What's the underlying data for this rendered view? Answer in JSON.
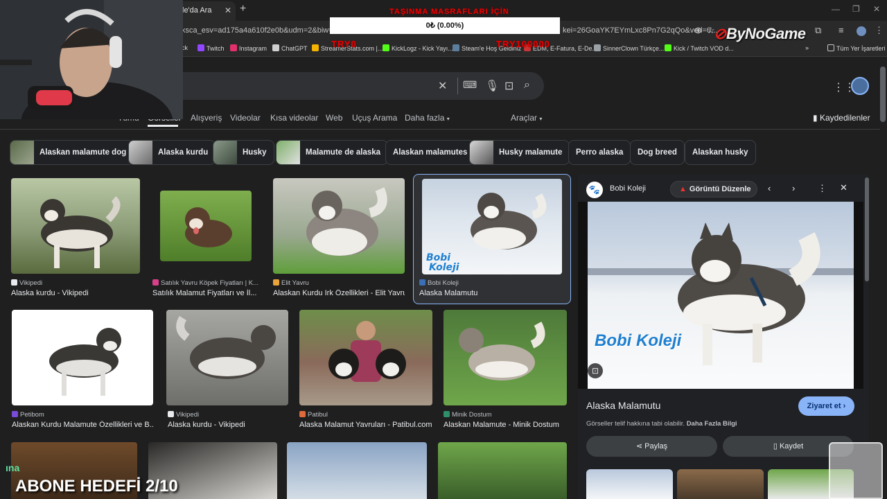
{
  "browser": {
    "tab_title": "le'da Ara",
    "url_left": "ksca_esv=ad175a4a610f2e0b&udm=2&biw=1745&",
    "url_right": "kei=26GoaYK7EYmLxc8Pn7G2qQo&ved=0...",
    "bookmarks": [
      {
        "label": "ck",
        "color": "#3a3a3a"
      },
      {
        "label": "Twitch",
        "color": "#9146ff"
      },
      {
        "label": "Instagram",
        "color": "#e1306c"
      },
      {
        "label": "ChatGPT",
        "color": "#d0d0d0"
      },
      {
        "label": "StreamerStats.com |...",
        "color": "#f3b400"
      },
      {
        "label": "KickLogz - Kick Yayı...",
        "color": "#53fc18"
      },
      {
        "label": "Steam'e Hoş Geldiniz",
        "color": "#5c7e9e"
      },
      {
        "label": "EDM, E-Fatura, E-De...",
        "color": "#c33"
      },
      {
        "label": "SinnerClown Türkçe...",
        "color": "#9aa0a6"
      },
      {
        "label": "Kick / Twitch VOD d...",
        "color": "#53fc18"
      }
    ],
    "all_bookmarks": "Tüm Yer İşaretleri"
  },
  "overlay": {
    "banner": "TAŞINMA MASRAFLARI İÇİN",
    "ticker": "0₺ (0.00%)",
    "left_amount": "TRY0",
    "right_amount": "TRY100000",
    "logo": "ByNoGame",
    "goal": "ABONE HEDEFİ 2/10",
    "corner_text": "ına"
  },
  "search": {
    "nav_tabs": [
      "Tümü",
      "Görseller",
      "Alışveriş",
      "Videolar",
      "Kısa videolar",
      "Web",
      "Uçuş Arama",
      "Daha fazla"
    ],
    "tools": "Araçlar",
    "saved": "Kaydedilenler",
    "chips": [
      "Alaskan malamute dog",
      "Alaska kurdu",
      "Husky",
      "Malamute de alaska",
      "Alaskan malamutes",
      "Husky malamute",
      "Perro alaska",
      "Dog breed",
      "Alaskan husky"
    ]
  },
  "results": [
    {
      "source": "Vikipedi",
      "title": "Alaska kurdu - Vikipedi",
      "color": "#e8eaed"
    },
    {
      "source": "Satılık Yavru Köpek Fiyatları | K...",
      "title": "Satılık Malamut Fiyatları ve İl...",
      "color": "#d6408b"
    },
    {
      "source": "Elit Yavru",
      "title": "Alaskan Kurdu Irk Özellikleri - Elit Yavru",
      "color": "#e8a43a"
    },
    {
      "source": "Bobi Koleji",
      "title": "Alaska Malamutu",
      "color": "#3b6fb6"
    },
    {
      "source": "Petibom",
      "title": "Alaskan Kurdu Malamute Özellikleri ve B...",
      "color": "#7a4ad8"
    },
    {
      "source": "Vikipedi",
      "title": "Alaska kurdu - Vikipedi",
      "color": "#e8eaed"
    },
    {
      "source": "Patibul",
      "title": "Alaska Malamut Yavruları - Patibul.com",
      "color": "#e06a3a"
    },
    {
      "source": "Minik Dostum",
      "title": "Alaskan Malamute - Minik Dostum",
      "color": "#2f8f6b"
    }
  ],
  "panel": {
    "site": "Bobi Koleji",
    "edit_button": "Görüntü Düzenle",
    "title": "Alaska Malamutu",
    "visit_button": "Ziyaret et",
    "copyright": "Görseller telif hakkına tabi olabilir.",
    "more_info": "Daha Fazla Bilgi",
    "share": "Paylaş",
    "save": "Kaydet",
    "watermark": "Bobi Koleji"
  }
}
